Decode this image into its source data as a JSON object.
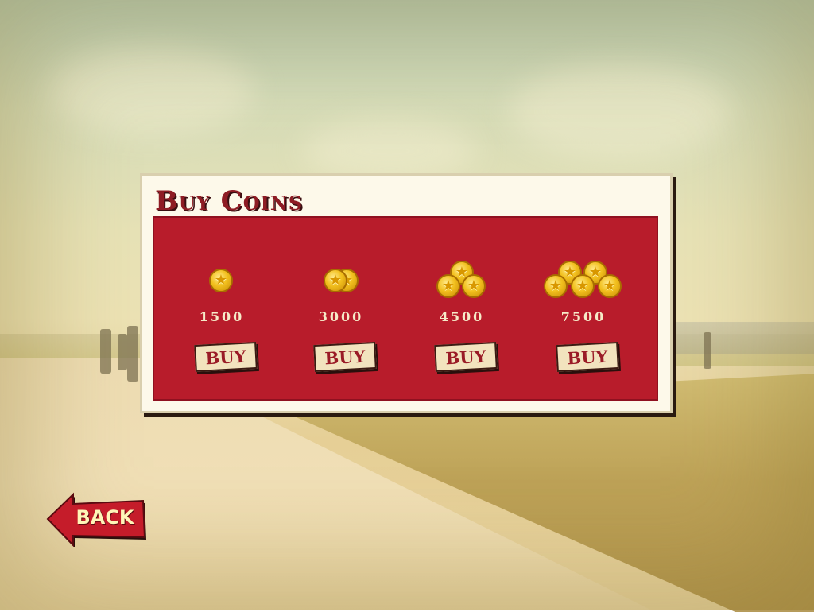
{
  "title": "Buy Coins",
  "offers": [
    {
      "amount": "1500",
      "buy_label": "BUY",
      "coin_icons": 1
    },
    {
      "amount": "3000",
      "buy_label": "BUY",
      "coin_icons": 2
    },
    {
      "amount": "4500",
      "buy_label": "BUY",
      "coin_icons": 3
    },
    {
      "amount": "7500",
      "buy_label": "BUY",
      "coin_icons": 5
    }
  ],
  "back_label": "BACK",
  "colors": {
    "panel_red": "#b81c2b",
    "title_red": "#8e1c24",
    "coin_gold": "#f2c01e",
    "button_bg": "#f2e3be"
  },
  "icons": [
    "coin-icon",
    "star-icon",
    "back-arrow-icon"
  ]
}
